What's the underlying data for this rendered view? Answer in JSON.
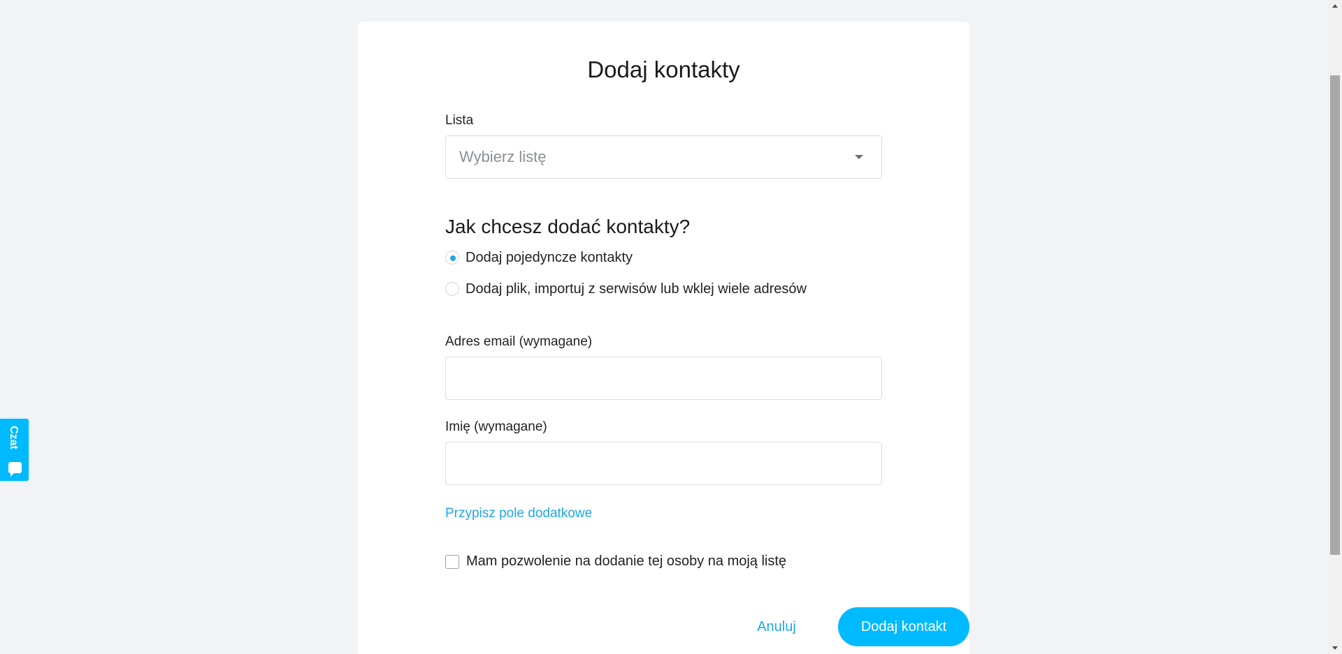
{
  "form": {
    "title": "Dodaj kontakty",
    "list": {
      "label": "Lista",
      "placeholder": "Wybierz listę"
    },
    "method": {
      "heading": "Jak chcesz dodać kontakty?",
      "options": [
        {
          "label": "Dodaj pojedyncze kontakty",
          "checked": true
        },
        {
          "label": "Dodaj plik, importuj z serwisów lub wklej wiele adresów",
          "checked": false
        }
      ]
    },
    "email": {
      "label": "Adres email (wymagane)",
      "value": ""
    },
    "name": {
      "label": "Imię (wymagane)",
      "value": ""
    },
    "custom_field_link": "Przypisz pole dodatkowe",
    "consent": {
      "label": "Mam pozwolenie na dodanie tej osoby na moją listę",
      "checked": false
    },
    "actions": {
      "cancel": "Anuluj",
      "submit": "Dodaj kontakt"
    }
  },
  "chat": {
    "label": "Czat",
    "icon": "chat-bubble-icon"
  },
  "colors": {
    "accent": "#00baff",
    "link": "#1fa7e6",
    "background": "#f1f3f6"
  }
}
